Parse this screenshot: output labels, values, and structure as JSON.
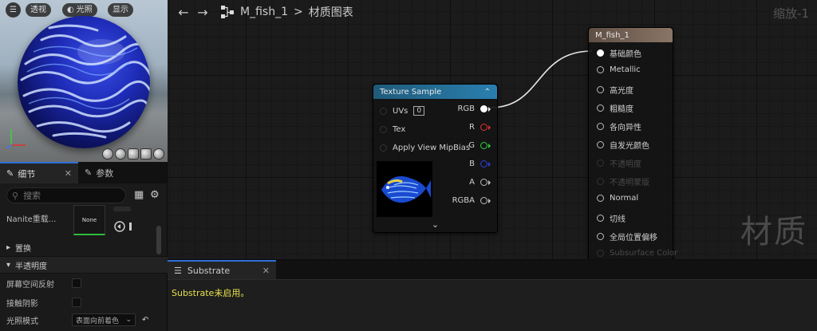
{
  "viewport": {
    "menu_icon": "hamburger-icon",
    "perspective_label": "透视",
    "lit_label": "光照",
    "show_label": "显示",
    "axis_x": "X",
    "axis_y": "Y",
    "axis_z": "Z",
    "preview_shapes": [
      "cylinder-icon",
      "sphere-icon",
      "plane-icon",
      "cube-icon",
      "teapot-icon"
    ]
  },
  "details": {
    "tab_details": "细节",
    "tab_params": "参数",
    "search_placeholder": "搜索",
    "nanite_label": "Nanite重载...",
    "nanite_value": "None",
    "section_replace": "置换",
    "section_translucency": "半透明度",
    "ssr_label": "屏幕空间反射",
    "contact_shadow_label": "接触阴影",
    "lighting_mode_label": "光照模式",
    "lighting_mode_value": "表面向前着色"
  },
  "graph": {
    "back_icon": "arrow-left-icon",
    "forward_icon": "arrow-right-icon",
    "asset_name": "M_fish_1",
    "separator": ">",
    "graph_name": "材质图表",
    "zoom": "缩放-1",
    "watermark": "材质"
  },
  "texture_node": {
    "title": "Texture Sample",
    "header_color": "#1f5a7a",
    "inputs": [
      "UVs",
      "Tex",
      "Apply View MipBias"
    ],
    "uv_value": "0",
    "outputs": [
      {
        "label": "RGB",
        "color": "#ffffff"
      },
      {
        "label": "R",
        "color": "#e03030"
      },
      {
        "label": "G",
        "color": "#30d040"
      },
      {
        "label": "B",
        "color": "#3040e0"
      },
      {
        "label": "A",
        "color": "#cccccc"
      },
      {
        "label": "RGBA",
        "color": "#cccccc"
      }
    ]
  },
  "material_node": {
    "title": "M_fish_1",
    "header_color": "#6b5a4e",
    "pins": [
      {
        "label": "基础颜色",
        "enabled": true
      },
      {
        "label": "Metallic",
        "enabled": true
      },
      {
        "label": "高光度",
        "enabled": true
      },
      {
        "label": "粗糙度",
        "enabled": true
      },
      {
        "label": "各向异性",
        "enabled": true
      },
      {
        "label": "自发光颜色",
        "enabled": true
      },
      {
        "label": "不透明度",
        "enabled": false
      },
      {
        "label": "不透明蒙版",
        "enabled": false
      },
      {
        "label": "Normal",
        "enabled": true
      },
      {
        "label": "切线",
        "enabled": true
      },
      {
        "label": "全局位置偏移",
        "enabled": true
      },
      {
        "label": "Subsurface Color",
        "enabled": false
      }
    ]
  },
  "substrate": {
    "tab_label": "Substrate",
    "message": "Substrate未启用。"
  }
}
